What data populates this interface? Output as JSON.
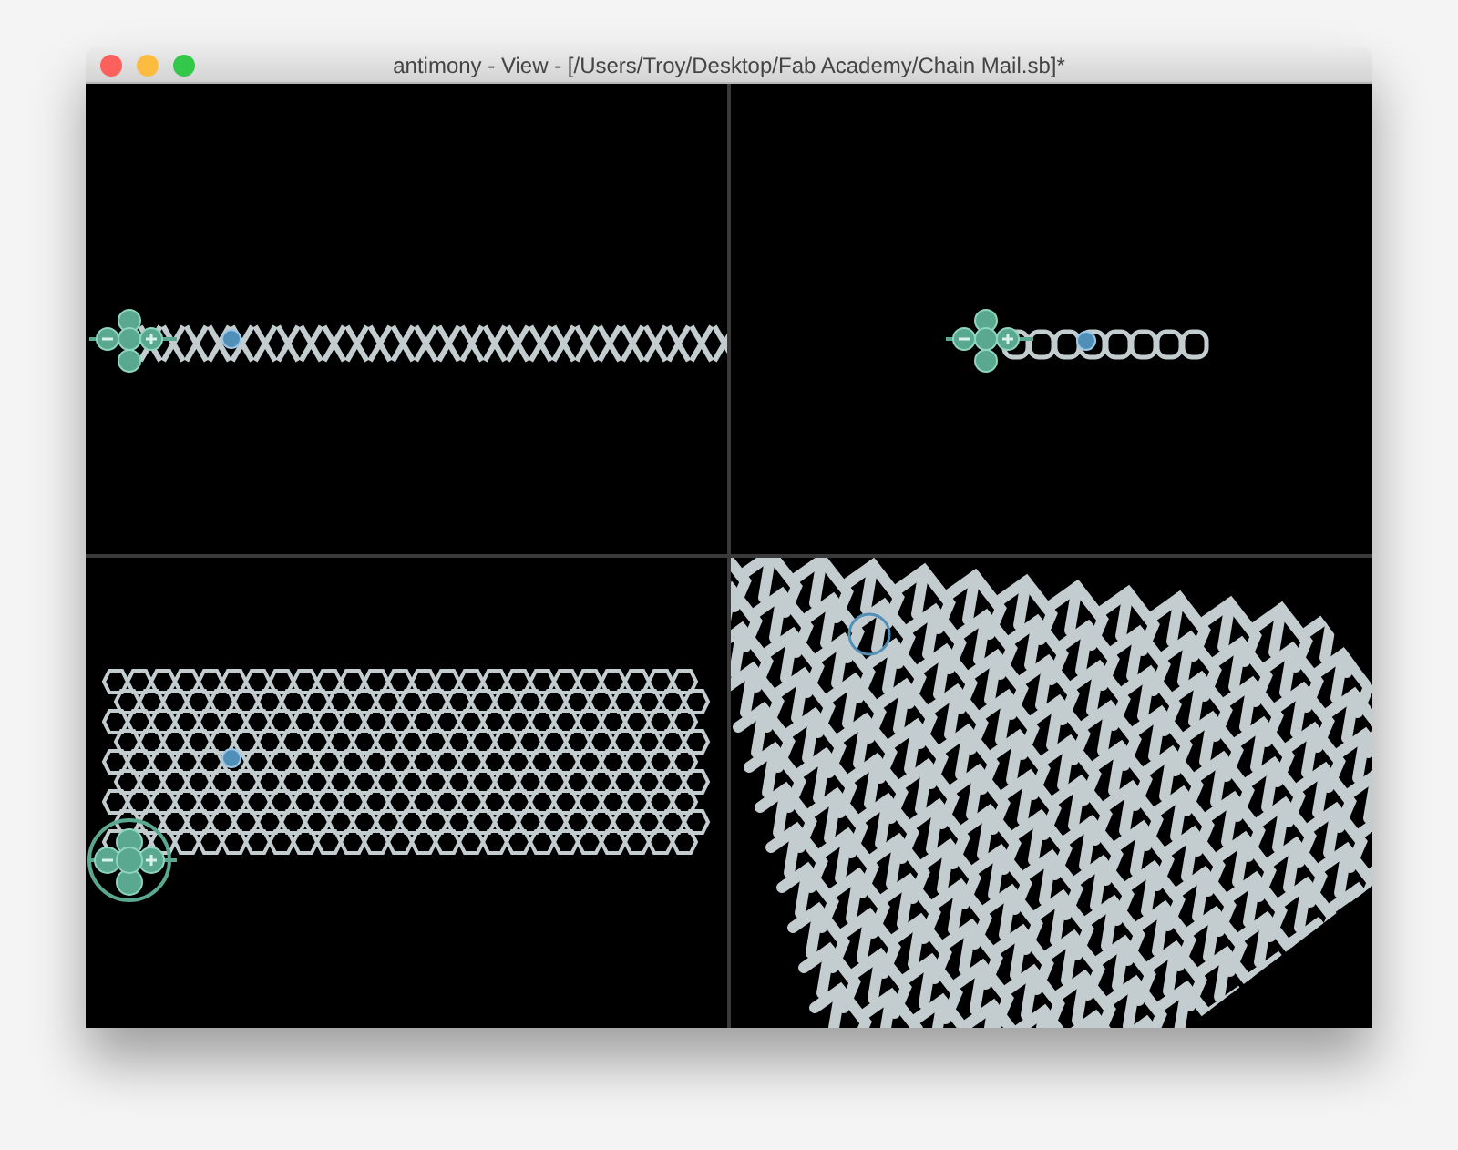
{
  "window": {
    "title": "antimony - View - [/Users/Troy/Desktop/Fab Academy/Chain Mail.sb]*"
  },
  "viewports": [
    {
      "kind": "front"
    },
    {
      "kind": "side"
    },
    {
      "kind": "top"
    },
    {
      "kind": "perspective"
    }
  ]
}
